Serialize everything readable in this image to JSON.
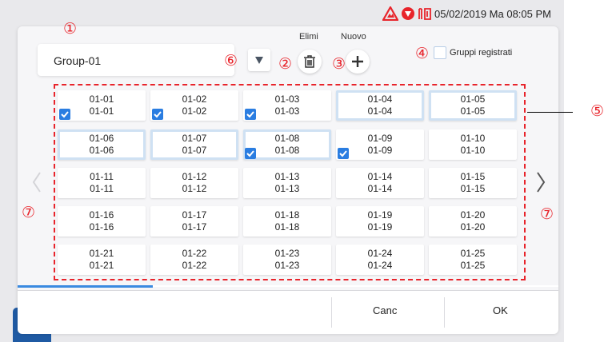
{
  "status_bar": {
    "datetime": "05/02/2019 Ma 08:05 PM",
    "icons": [
      "warning-icon",
      "shield-icon",
      "device-icon"
    ]
  },
  "dialog": {
    "group_name": "Group-01",
    "buttons": {
      "delete_label": "Elimi",
      "new_label": "Nuovo",
      "cancel": "Canc",
      "ok": "OK"
    },
    "registered_groups_label": "Gruppi registrati",
    "progress_fraction": 0.25,
    "callouts": {
      "c1": "①",
      "c2": "②",
      "c3": "③",
      "c4": "④",
      "c5": "⑤",
      "c6": "⑥",
      "c7": "⑦"
    },
    "cells": [
      {
        "line1": "01-01",
        "line2": "01-01",
        "checked": true,
        "selected": false
      },
      {
        "line1": "01-02",
        "line2": "01-02",
        "checked": true,
        "selected": false
      },
      {
        "line1": "01-03",
        "line2": "01-03",
        "checked": true,
        "selected": false
      },
      {
        "line1": "01-04",
        "line2": "01-04",
        "checked": false,
        "selected": true
      },
      {
        "line1": "01-05",
        "line2": "01-05",
        "checked": false,
        "selected": true
      },
      {
        "line1": "01-06",
        "line2": "01-06",
        "checked": false,
        "selected": true
      },
      {
        "line1": "01-07",
        "line2": "01-07",
        "checked": false,
        "selected": true
      },
      {
        "line1": "01-08",
        "line2": "01-08",
        "checked": true,
        "selected": true
      },
      {
        "line1": "01-09",
        "line2": "01-09",
        "checked": true,
        "selected": false
      },
      {
        "line1": "01-10",
        "line2": "01-10",
        "checked": false,
        "selected": false
      },
      {
        "line1": "01-11",
        "line2": "01-11",
        "checked": false,
        "selected": false
      },
      {
        "line1": "01-12",
        "line2": "01-12",
        "checked": false,
        "selected": false
      },
      {
        "line1": "01-13",
        "line2": "01-13",
        "checked": false,
        "selected": false
      },
      {
        "line1": "01-14",
        "line2": "01-14",
        "checked": false,
        "selected": false
      },
      {
        "line1": "01-15",
        "line2": "01-15",
        "checked": false,
        "selected": false
      },
      {
        "line1": "01-16",
        "line2": "01-16",
        "checked": false,
        "selected": false
      },
      {
        "line1": "01-17",
        "line2": "01-17",
        "checked": false,
        "selected": false
      },
      {
        "line1": "01-18",
        "line2": "01-18",
        "checked": false,
        "selected": false
      },
      {
        "line1": "01-19",
        "line2": "01-19",
        "checked": false,
        "selected": false
      },
      {
        "line1": "01-20",
        "line2": "01-20",
        "checked": false,
        "selected": false
      },
      {
        "line1": "01-21",
        "line2": "01-21",
        "checked": false,
        "selected": false
      },
      {
        "line1": "01-22",
        "line2": "01-22",
        "checked": false,
        "selected": false
      },
      {
        "line1": "01-23",
        "line2": "01-23",
        "checked": false,
        "selected": false
      },
      {
        "line1": "01-24",
        "line2": "01-24",
        "checked": false,
        "selected": false
      },
      {
        "line1": "01-25",
        "line2": "01-25",
        "checked": false,
        "selected": false
      }
    ]
  },
  "colors": {
    "accent": "#2a7de1",
    "callout": "#e8242b",
    "nav_blue": "#1f5aa3"
  }
}
